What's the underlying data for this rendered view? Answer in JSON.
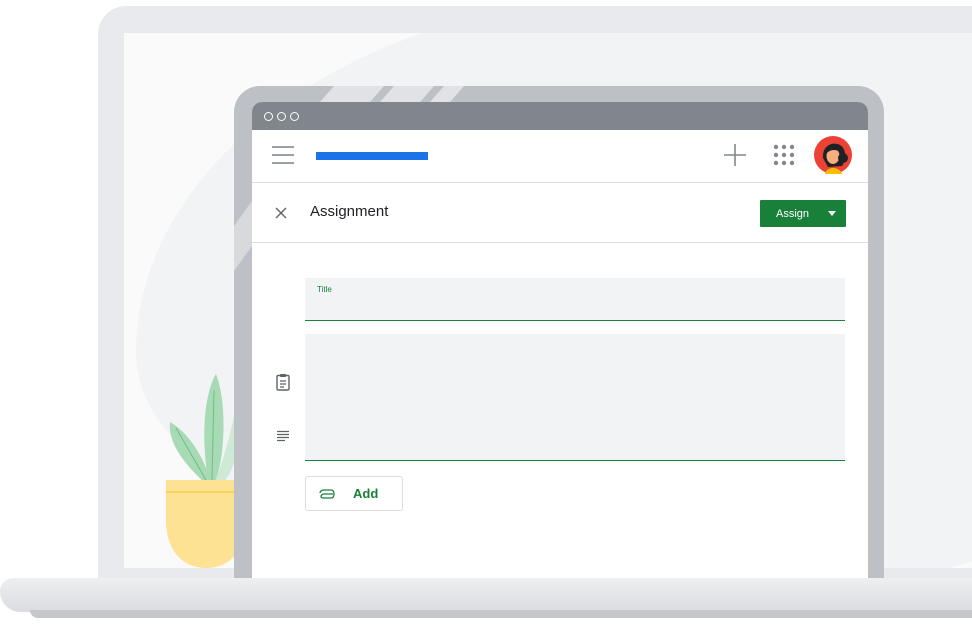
{
  "form": {
    "title": "Assignment",
    "assign_label": "Assign",
    "title_field_label": "Title",
    "add_label": "Add"
  },
  "icons": {
    "close": "close-icon",
    "menu": "hamburger-menu-icon",
    "plus": "plus-icon",
    "apps": "apps-grid-icon",
    "avatar": "user-avatar",
    "clipboard": "clipboard-icon",
    "notes": "notes-icon",
    "attach": "paperclip-icon"
  },
  "colors": {
    "accent_green": "#188038",
    "brand_blue": "#1a73e8",
    "titlebar_gray": "#80868b"
  }
}
